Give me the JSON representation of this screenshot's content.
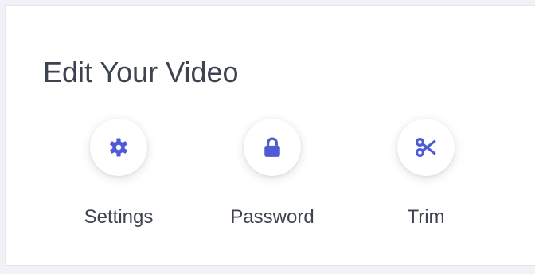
{
  "panel": {
    "title": "Edit Your Video"
  },
  "accent_color": "#4f5bd5",
  "actions": [
    {
      "label": "Settings",
      "icon": "gear-icon"
    },
    {
      "label": "Password",
      "icon": "lock-icon"
    },
    {
      "label": "Trim",
      "icon": "scissors-icon"
    }
  ]
}
